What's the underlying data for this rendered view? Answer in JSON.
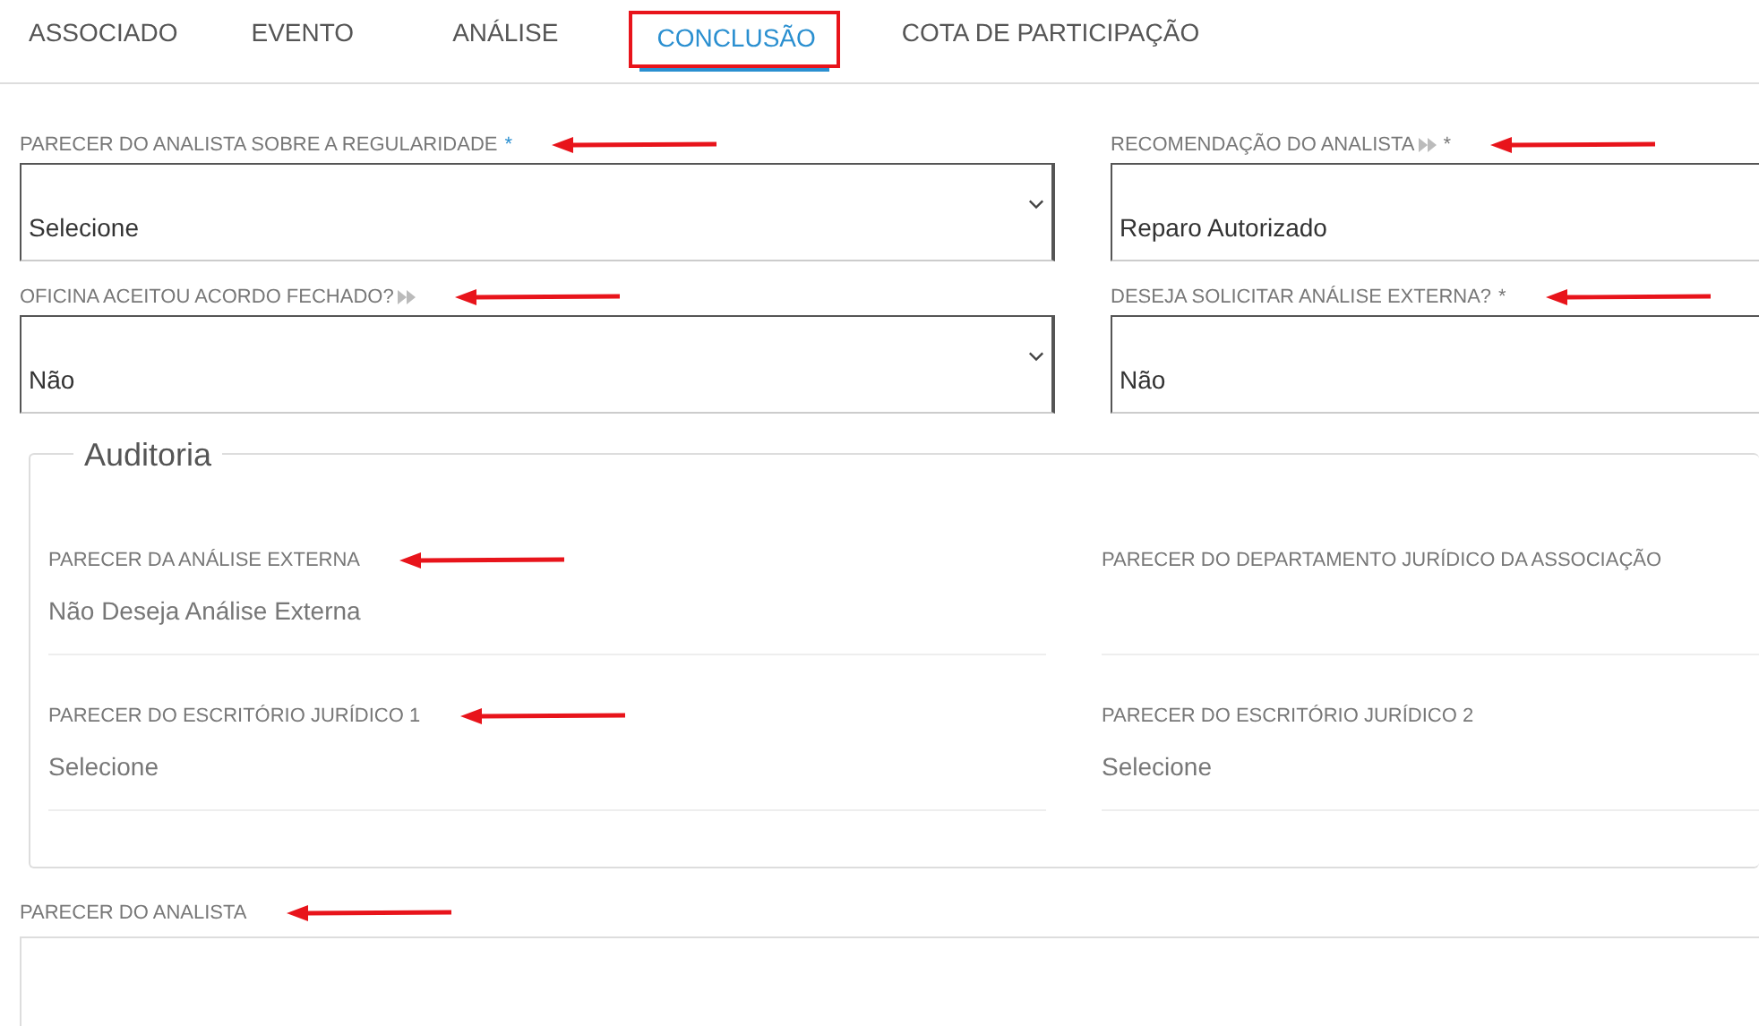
{
  "tabs": [
    {
      "label": "ASSOCIADO",
      "selected": false,
      "highlighted": false
    },
    {
      "label": "EVENTO",
      "selected": false,
      "highlighted": false
    },
    {
      "label": "ANÁLISE",
      "selected": false,
      "highlighted": false
    },
    {
      "label": "CONCLUSÃO",
      "selected": true,
      "highlighted": true
    },
    {
      "label": "COTA DE PARTICIPAÇÃO",
      "selected": false,
      "highlighted": false
    }
  ],
  "fields": [
    {
      "label": "PARECER DO ANALISTA SOBRE A REGULARIDADE",
      "required_mark": "*",
      "value": "Selecione",
      "dropdown": true,
      "annotated": true
    },
    {
      "label": "RECOMENDAÇÃO DO ANALISTA",
      "info_icon": true,
      "required_mark": "*",
      "value": "Reparo Autorizado",
      "annotated": true
    },
    {
      "label": "OFICINA ACEITOU ACORDO FECHADO?",
      "info_icon": true,
      "value": "Não",
      "dropdown": true,
      "annotated": true
    },
    {
      "label": "DESEJA SOLICITAR ANÁLISE EXTERNA?",
      "required_mark": "*",
      "value": "Não",
      "annotated": true
    }
  ],
  "auditoria": {
    "legend": "Auditoria",
    "items": [
      {
        "label": "PARECER DA ANÁLISE EXTERNA",
        "value": "Não Deseja Análise Externa",
        "annotated": true
      },
      {
        "label": "PARECER DO DEPARTAMENTO JURÍDICO DA ASSOCIAÇÃO"
      },
      {
        "label": "PARECER DO ESCRITÓRIO JURÍDICO 1",
        "value": "Selecione",
        "annotated": true
      },
      {
        "label": "PARECER DO ESCRITÓRIO JURÍDICO 2",
        "value": "Selecione"
      }
    ]
  },
  "parecer": {
    "label": "PARECER DO ANALISTA",
    "annotated": true
  }
}
